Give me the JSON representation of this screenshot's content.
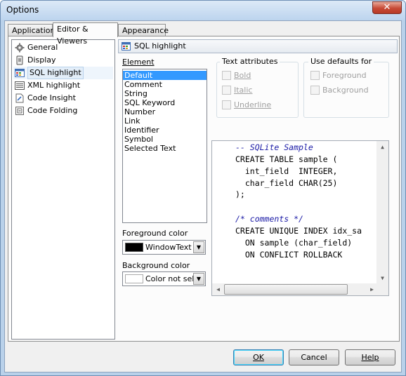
{
  "window": {
    "title": "Options",
    "close_glyph": "✕"
  },
  "tabs": [
    {
      "label": "Application",
      "active": false
    },
    {
      "label": "Editor & Viewers",
      "active": true
    },
    {
      "label": "Appearance",
      "active": false
    }
  ],
  "nav": {
    "items": [
      {
        "label": "General",
        "icon": "gear-icon",
        "selected": false
      },
      {
        "label": "Display",
        "icon": "display-icon",
        "selected": false
      },
      {
        "label": "SQL highlight",
        "icon": "sql-highlight-icon",
        "selected": true
      },
      {
        "label": "XML highlight",
        "icon": "xml-highlight-icon",
        "selected": false
      },
      {
        "label": "Code Insight",
        "icon": "code-insight-icon",
        "selected": false
      },
      {
        "label": "Code Folding",
        "icon": "code-folding-icon",
        "selected": false
      }
    ]
  },
  "section": {
    "title": "SQL highlight"
  },
  "element": {
    "label": "Element",
    "items": [
      "Default",
      "Comment",
      "String",
      "SQL Keyword",
      "Number",
      "Link",
      "Identifier",
      "Symbol",
      "Selected Text"
    ],
    "selected_index": 0
  },
  "foreground": {
    "label": "Foreground color",
    "value": "WindowText",
    "swatch_color": "#000000"
  },
  "background": {
    "label": "Background color",
    "value": "Color not sele",
    "swatch_color": "#ffffff"
  },
  "text_attributes": {
    "title": "Text attributes",
    "options": [
      {
        "label": "Bold",
        "checked": false
      },
      {
        "label": "Italic",
        "checked": false
      },
      {
        "label": "Underline",
        "checked": false
      }
    ]
  },
  "use_defaults": {
    "title": "Use defaults for",
    "options": [
      {
        "label": "Foreground",
        "checked": false
      },
      {
        "label": "Background",
        "checked": false
      }
    ]
  },
  "preview": {
    "lines": [
      {
        "text": "-- SQLite Sample",
        "style": "comment"
      },
      {
        "text": "CREATE TABLE sample (",
        "style": "normal"
      },
      {
        "text": "  int_field  INTEGER,",
        "style": "normal"
      },
      {
        "text": "  char_field CHAR(25)",
        "style": "normal"
      },
      {
        "text": ");",
        "style": "normal"
      },
      {
        "text": "",
        "style": "normal"
      },
      {
        "text": "/* comments */",
        "style": "comment"
      },
      {
        "text": "CREATE UNIQUE INDEX idx_sa",
        "style": "normal"
      },
      {
        "text": "  ON sample (char_field)",
        "style": "normal"
      },
      {
        "text": "  ON CONFLICT ROLLBACK",
        "style": "normal"
      }
    ]
  },
  "buttons": {
    "ok": "OK",
    "cancel": "Cancel",
    "help": "Help"
  },
  "colors": {
    "selection": "#3399ff",
    "comment_text": "#1a1aa6",
    "window_frame": "#b9d1ea"
  }
}
